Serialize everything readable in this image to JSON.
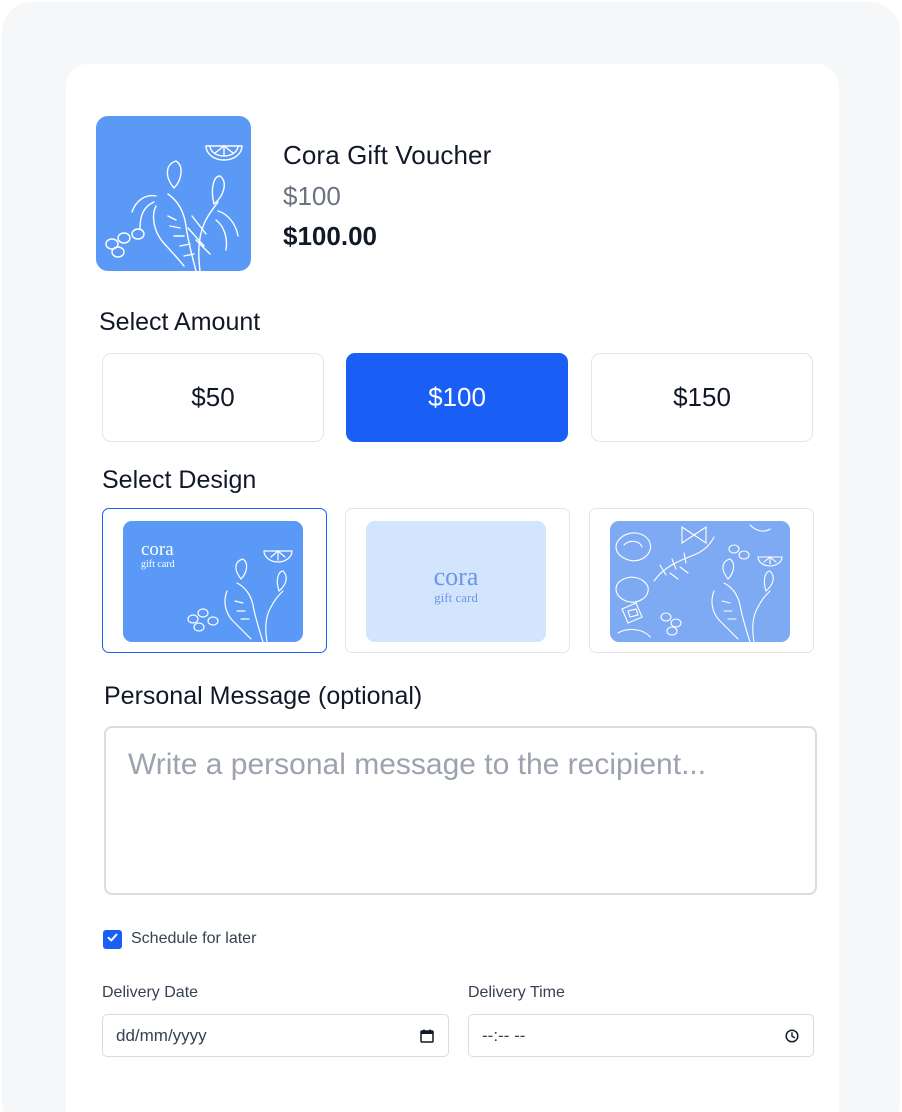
{
  "product": {
    "name": "Cora Gift Voucher",
    "price_original": "$100",
    "price_current": "$100.00"
  },
  "amount": {
    "label": "Select Amount",
    "options": [
      "$50",
      "$100",
      "$150"
    ],
    "selected": "$100"
  },
  "design": {
    "label": "Select Design",
    "options": [
      {
        "brand": "cora",
        "subtitle": "gift card",
        "style": "blue-illustrated"
      },
      {
        "brand": "cora",
        "subtitle": "gift card",
        "style": "light-blue-plain"
      },
      {
        "brand": "",
        "subtitle": "",
        "style": "pattern-seafood"
      }
    ],
    "selected_index": 0
  },
  "message": {
    "label": "Personal Message (optional)",
    "placeholder": "Write a personal message to the recipient..."
  },
  "schedule": {
    "label": "Schedule for later",
    "checked": true
  },
  "delivery": {
    "date_label": "Delivery Date",
    "date_placeholder": "dd/mm/yyyy",
    "time_label": "Delivery Time",
    "time_placeholder": "--:-- --"
  },
  "icons": {
    "checkbox": "check-icon",
    "date": "calendar-icon",
    "time": "clock-icon"
  },
  "colors": {
    "accent": "#1a5ff5",
    "card_blue": "#5b99f7",
    "card_light": "#d3e4fd",
    "card_pattern": "#7eaaf3",
    "page_bg": "#f6f7f9"
  }
}
